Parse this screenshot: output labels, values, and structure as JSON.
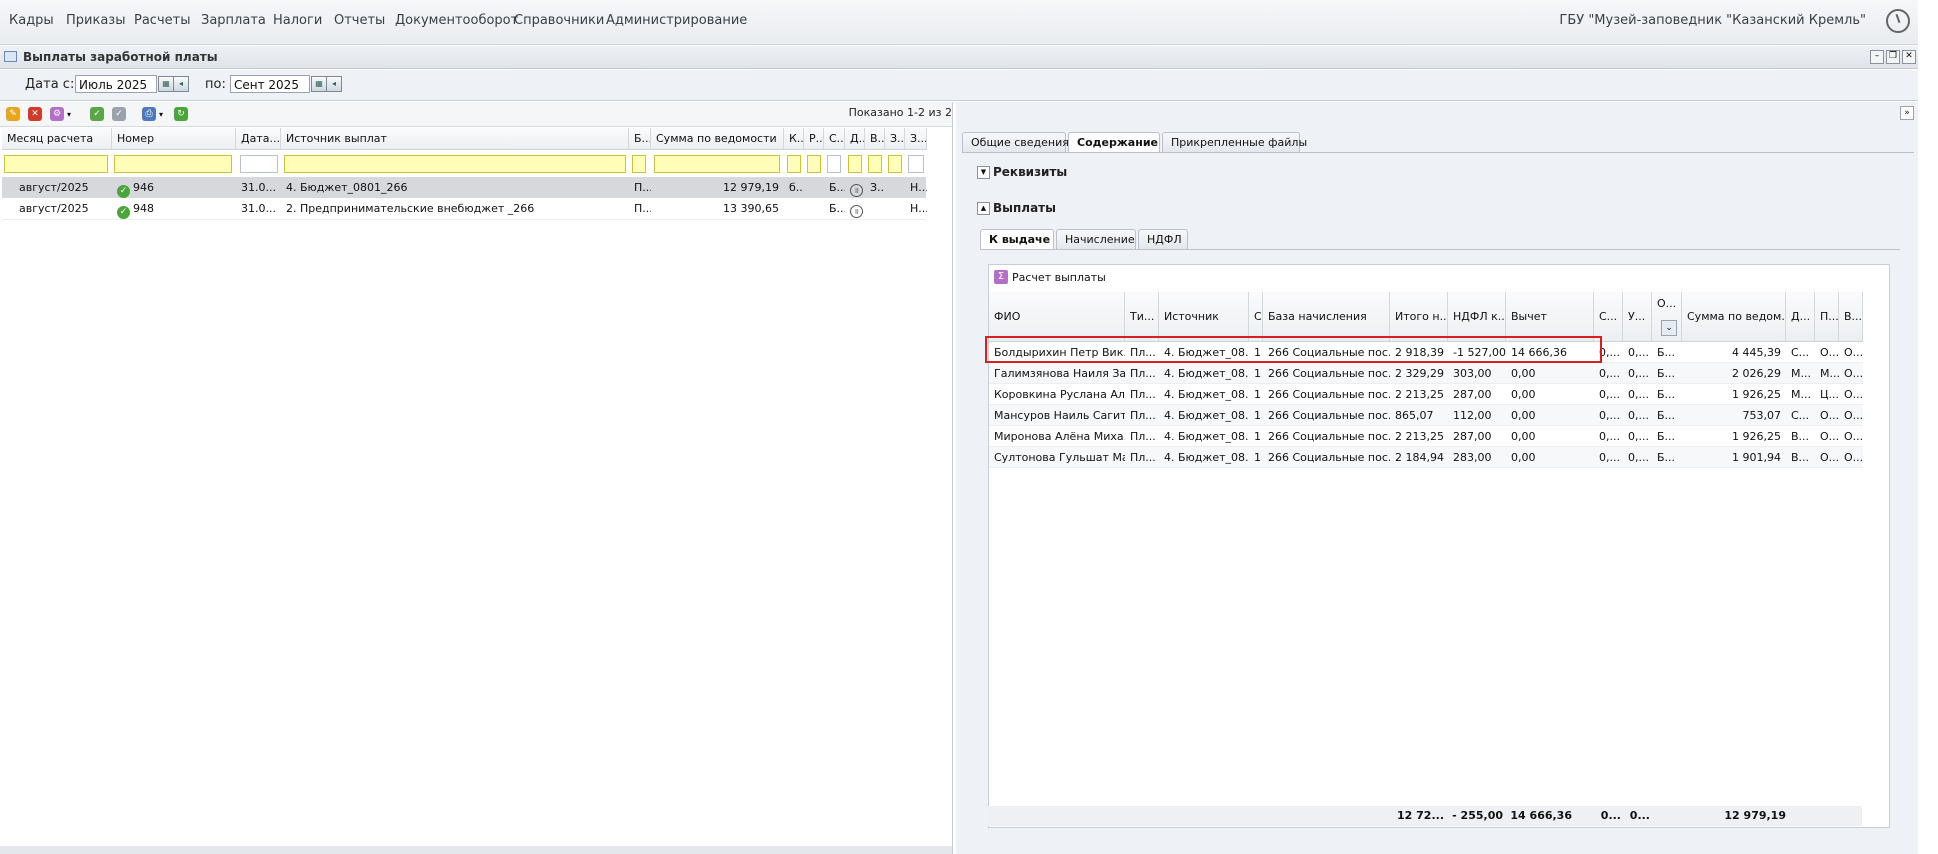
{
  "menu": [
    "Кадры",
    "Приказы",
    "Расчеты",
    "Зарплата",
    "Налоги",
    "Отчеты",
    "Документооборот",
    "Справочники",
    "Администрирование"
  ],
  "org": "ГБУ \"Музей-заповедник \"Казанский Кремль\"",
  "window_title": "Выплаты заработной платы",
  "datebar": {
    "from_label": "Дата с:",
    "from_value": "Июль 2025",
    "to_label": "по:",
    "to_value": "Сент 2025"
  },
  "left": {
    "shown": "Показано 1-2 из 2",
    "headers": [
      "Месяц расчета",
      "Номер",
      "Дата...",
      "Источник выплат",
      "Б...",
      "Сумма по ведомости",
      "К...",
      "Р...",
      "С...",
      "Д...",
      "В...",
      "З...",
      "З..."
    ],
    "rows": [
      {
        "month": "август/2025",
        "number": "946",
        "date": "31.0...",
        "source": "4. Бюджет_0801_266",
        "b": "П...",
        "sum": "12 979,19",
        "k": "б...",
        "s": "Б...",
        "z": "З...",
        "z2": "Н..."
      },
      {
        "month": "август/2025",
        "number": "948",
        "date": "31.0...",
        "source": "2. Предпринимательские внебюджет _266",
        "b": "П...",
        "sum": "13 390,65",
        "k": "",
        "s": "Б...",
        "z": "",
        "z2": "Н..."
      }
    ]
  },
  "right": {
    "tabs": [
      "Общие сведения",
      "Содержание",
      "Прикрепленные файлы"
    ],
    "section1": "Реквизиты",
    "section2": "Выплаты",
    "subtabs": [
      "К выдаче",
      "Начисление",
      "НДФЛ"
    ],
    "calc_label": "Расчет выплаты",
    "headers": [
      "ФИО",
      "Ти...",
      "Источник",
      "С",
      "База начисления",
      "Итого н...",
      "НДФЛ к...",
      "Вычет",
      "С...",
      "У...",
      "О...",
      "Сумма по ведом...",
      "Д...",
      "П...",
      "В..."
    ],
    "rows": [
      [
        "Болдырихин Петр Вик...",
        "Пл...",
        "4. Бюджет_08...",
        "1",
        "266 Социальные пос...",
        "2 918,39",
        "-1 527,00",
        "14 666,36",
        "0,...",
        "0,...",
        "Б...",
        "4 445,39",
        "С...",
        "О...",
        "О..."
      ],
      [
        "Галимзянова Наиля За...",
        "Пл...",
        "4. Бюджет_08...",
        "1",
        "266 Социальные пос...",
        "2 329,29",
        "303,00",
        "0,00",
        "0,...",
        "0,...",
        "Б...",
        "2 026,29",
        "М...",
        "М...",
        "О..."
      ],
      [
        "Коровкина Руслана Ал...",
        "Пл...",
        "4. Бюджет_08...",
        "1",
        "266 Социальные пос...",
        "2 213,25",
        "287,00",
        "0,00",
        "0,...",
        "0,...",
        "Б...",
        "1 926,25",
        "М...",
        "Ц...",
        "О..."
      ],
      [
        "Мансуров Наиль Сагит...",
        "Пл...",
        "4. Бюджет_08...",
        "1",
        "266 Социальные пос...",
        "865,07",
        "112,00",
        "0,00",
        "0,...",
        "0,...",
        "Б...",
        "753,07",
        "С...",
        "О...",
        "О..."
      ],
      [
        "Миронова Алёна Миха...",
        "Пл...",
        "4. Бюджет_08...",
        "1",
        "266 Социальные пос...",
        "2 213,25",
        "287,00",
        "0,00",
        "0,...",
        "0,...",
        "Б...",
        "1 926,25",
        "В...",
        "О...",
        "О..."
      ],
      [
        "Султонова Гульшат Ма...",
        "Пл...",
        "4. Бюджет_08...",
        "1",
        "266 Социальные пос...",
        "2 184,94",
        "283,00",
        "0,00",
        "0,...",
        "0,...",
        "Б...",
        "1 901,94",
        "В...",
        "О...",
        "О..."
      ]
    ],
    "totals": {
      "itogo": "12 72...",
      "ndfl": "- 255,00",
      "vychet": "14 666,36",
      "s": "0...",
      "u": "0...",
      "sum": "12 979,19"
    }
  }
}
